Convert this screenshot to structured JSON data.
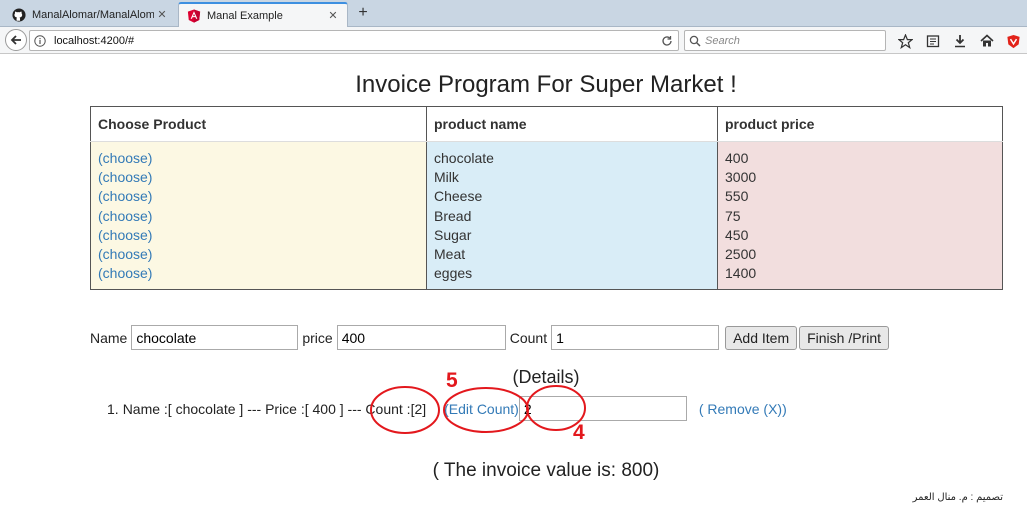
{
  "browser": {
    "tabs": [
      {
        "label": "ManalAlomar/ManalAlomar",
        "icon": "github-icon",
        "active": false
      },
      {
        "label": "Manal Example",
        "icon": "angular-icon",
        "active": true
      }
    ],
    "url": "localhost:4200/#",
    "search_placeholder": "Search"
  },
  "page": {
    "title": "Invoice Program For Super Market !",
    "table": {
      "headers": [
        "Choose Product",
        "product name",
        "product price"
      ],
      "rows": [
        {
          "action": "(choose)",
          "name": "chocolate",
          "price": "400"
        },
        {
          "action": "(choose)",
          "name": "Milk",
          "price": "3000"
        },
        {
          "action": "(choose)",
          "name": "Cheese",
          "price": "550"
        },
        {
          "action": "(choose)",
          "name": "Bread",
          "price": "75"
        },
        {
          "action": "(choose)",
          "name": "Sugar",
          "price": "450"
        },
        {
          "action": "(choose)",
          "name": "Meat",
          "price": "2500"
        },
        {
          "action": "(choose)",
          "name": "egges",
          "price": "1400"
        }
      ]
    },
    "form": {
      "name_label": "Name",
      "name_value": "chocolate",
      "price_label": "price",
      "price_value": "400",
      "count_label": "Count",
      "count_value": "1",
      "add_button": "Add Item",
      "finish_button": "Finish /Print"
    },
    "details": {
      "title": "(Details)",
      "item": {
        "index": "1.",
        "text": "Name :[ chocolate ] --- Price :[ 400 ] --- Count :[2]",
        "edit_label": "(Edit Count)",
        "edit_value": "2",
        "remove_label": "( Remove (X))"
      }
    },
    "total": "( The invoice value is: 800)",
    "designer": "تصميم : م. منال العمر"
  },
  "annotations": {
    "labels": [
      "5",
      "4"
    ],
    "color": "#e3181d"
  }
}
